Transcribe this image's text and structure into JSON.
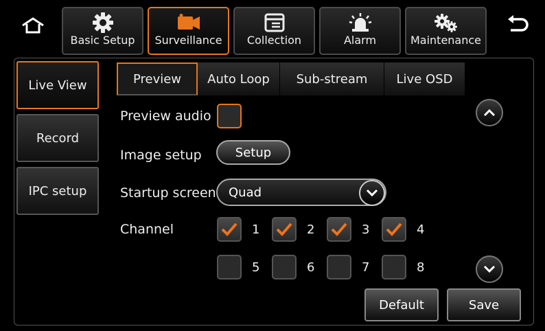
{
  "top_tabs": [
    {
      "label": "Basic Setup",
      "icon": "gear-icon"
    },
    {
      "label": "Surveillance",
      "icon": "camera-icon"
    },
    {
      "label": "Collection",
      "icon": "window-icon"
    },
    {
      "label": "Alarm",
      "icon": "alarm-light-icon"
    },
    {
      "label": "Maintenance",
      "icon": "gears-icon"
    }
  ],
  "side_menu": [
    {
      "label": "Live View"
    },
    {
      "label": "Record"
    },
    {
      "label": "IPC setup"
    }
  ],
  "sub_tabs": [
    {
      "label": "Preview"
    },
    {
      "label": "Auto Loop"
    },
    {
      "label": "Sub-stream"
    },
    {
      "label": "Live OSD"
    }
  ],
  "form": {
    "preview_audio_label": "Preview audio",
    "image_setup_label": "Image setup",
    "setup_button": "Setup",
    "startup_screen_label": "Startup screen",
    "startup_screen_value": "Quad",
    "channel_label": "Channel",
    "channels": [
      {
        "num": "1",
        "checked": true
      },
      {
        "num": "2",
        "checked": true
      },
      {
        "num": "3",
        "checked": true
      },
      {
        "num": "4",
        "checked": true
      },
      {
        "num": "5",
        "checked": false
      },
      {
        "num": "6",
        "checked": false
      },
      {
        "num": "7",
        "checked": false
      },
      {
        "num": "8",
        "checked": false
      }
    ]
  },
  "actions": {
    "default_label": "Default",
    "save_label": "Save"
  },
  "colors": {
    "accent": "#e8761b",
    "background": "#000000"
  }
}
